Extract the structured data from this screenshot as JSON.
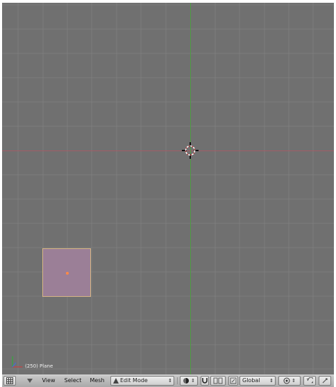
{
  "viewport": {
    "object_label": "(250) Plane"
  },
  "header": {
    "menus": {
      "view": "View",
      "select": "Select",
      "mesh": "Mesh"
    },
    "mode": {
      "label": "Edit Mode",
      "icon": "triangle-icon"
    },
    "pivot": {
      "label": "Global"
    }
  },
  "colors": {
    "viewport_background": "#707070",
    "grid_line": "#7d7d7d",
    "x_axis": "#a35d66",
    "y_axis": "#4f9c43",
    "plane_fill": "#9b7f97",
    "plane_outline": "#d8b784",
    "object_center": "#ff8a46",
    "header_background": "#b8b8b8"
  },
  "icons": {
    "editor_type": "grid-icon",
    "menu_toggle": "triangle-down-icon",
    "draw_type": "shading-icon",
    "magnet": "magnet-icon",
    "selection": "vertex-select-icon",
    "pivot": "pivot-icon",
    "snap": "snap-icon",
    "undo": "undo-icon"
  }
}
